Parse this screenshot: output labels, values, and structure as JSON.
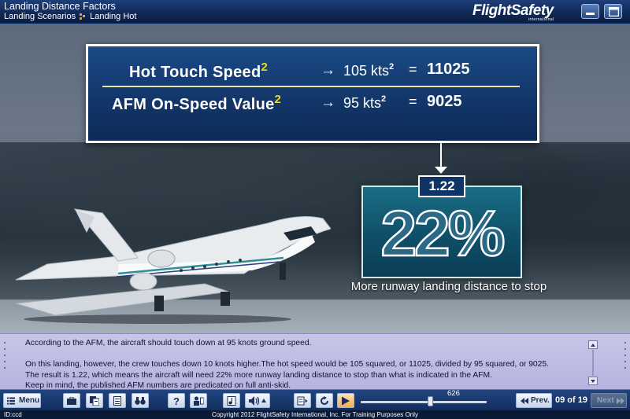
{
  "header": {
    "title": "Landing Distance Factors",
    "breadcrumb": [
      "Landing Scenarios",
      "Landing Hot"
    ],
    "logo": "FlightSafety",
    "logo_sub": "international"
  },
  "formula": {
    "row1": {
      "label": "Hot Touch Speed",
      "exp": "2",
      "arrow": "→",
      "value": "105 kts",
      "value_exp": "2",
      "eq": "=",
      "result": "11025"
    },
    "row2": {
      "label": "AFM On-Speed Value",
      "exp": "2",
      "arrow": "→",
      "value": "95 kts",
      "value_exp": "2",
      "eq": "=",
      "result": "9025"
    }
  },
  "result": {
    "ratio": "1.22",
    "percent": "22%",
    "caption": "More runway landing distance to stop"
  },
  "narration": {
    "lines": [
      "According to the AFM, the aircraft should touch down at 95 knots ground speed.",
      "",
      "On this landing, however, the crew touches down 10 knots higher.The hot speed would be 105 squared, or 11025, divided by 95 squared, or 9025.",
      "The result is 1.22, which means the aircraft will need 22% more runway landing distance to stop than what is indicated in the AFM.",
      "Keep in mind, the published AFM numbers are predicated on full anti-skid."
    ]
  },
  "toolbar": {
    "menu_label": "Menu",
    "seek_value": "626",
    "seek_fraction": 0.55,
    "prev_label": "Prev.",
    "page_counter": "09 of 19",
    "next_label": "Next"
  },
  "status": {
    "id": "ID:ccd",
    "copyright": "Copyright  2012 FlightSafety International, Inc. For Training Purposes Only"
  },
  "colors": {
    "header_bg": "#0f2753",
    "formula_bg": "#123568",
    "result_bg": "#0f4f68",
    "narration_bg": "#c8c5e8",
    "accent_exponent": "#f0d81c",
    "play_accent": "#f7ad48"
  }
}
